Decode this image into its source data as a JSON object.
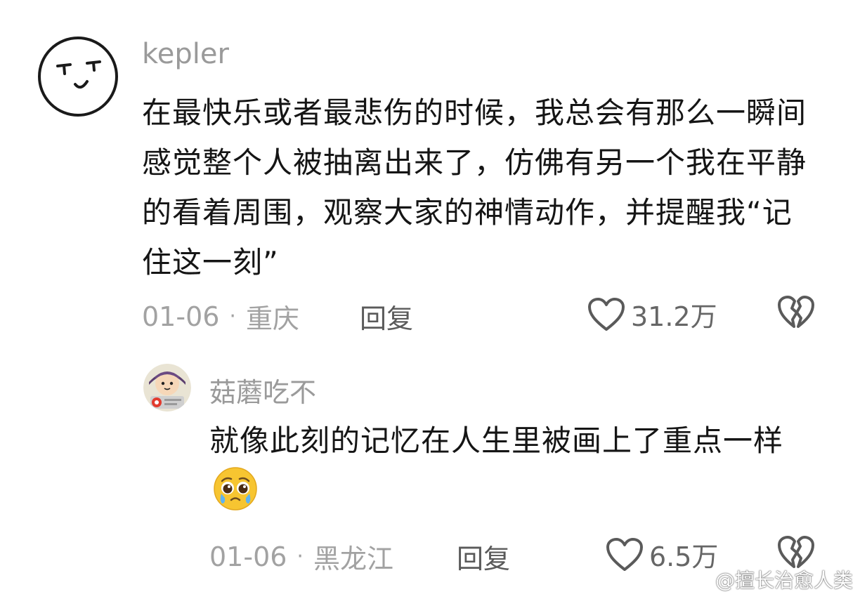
{
  "comments": [
    {
      "username": "kepler",
      "text": "在最快乐或者最悲伤的时候，我总会有那么一瞬间感觉整个人被抽离出来了，仿佛有另一个我在平静的看着周围，观察大家的神情动作，并提醒我“记住这一刻”",
      "date": "01-06",
      "location": "重庆",
      "reply_label": "回复",
      "likes": "31.2万"
    },
    {
      "username": "菇蘑吃不",
      "text": "就像此刻的记忆在人生里被画上了重点一样",
      "emoji": "pleading-tear-face",
      "date": "01-06",
      "location": "黑龙江",
      "reply_label": "回复",
      "likes": "6.5万"
    }
  ],
  "watermark": "@擅长治愈人类",
  "icons": {
    "like": "heart-outline-icon",
    "dislike": "broken-heart-icon",
    "watermark": "weibo-logo-icon"
  }
}
